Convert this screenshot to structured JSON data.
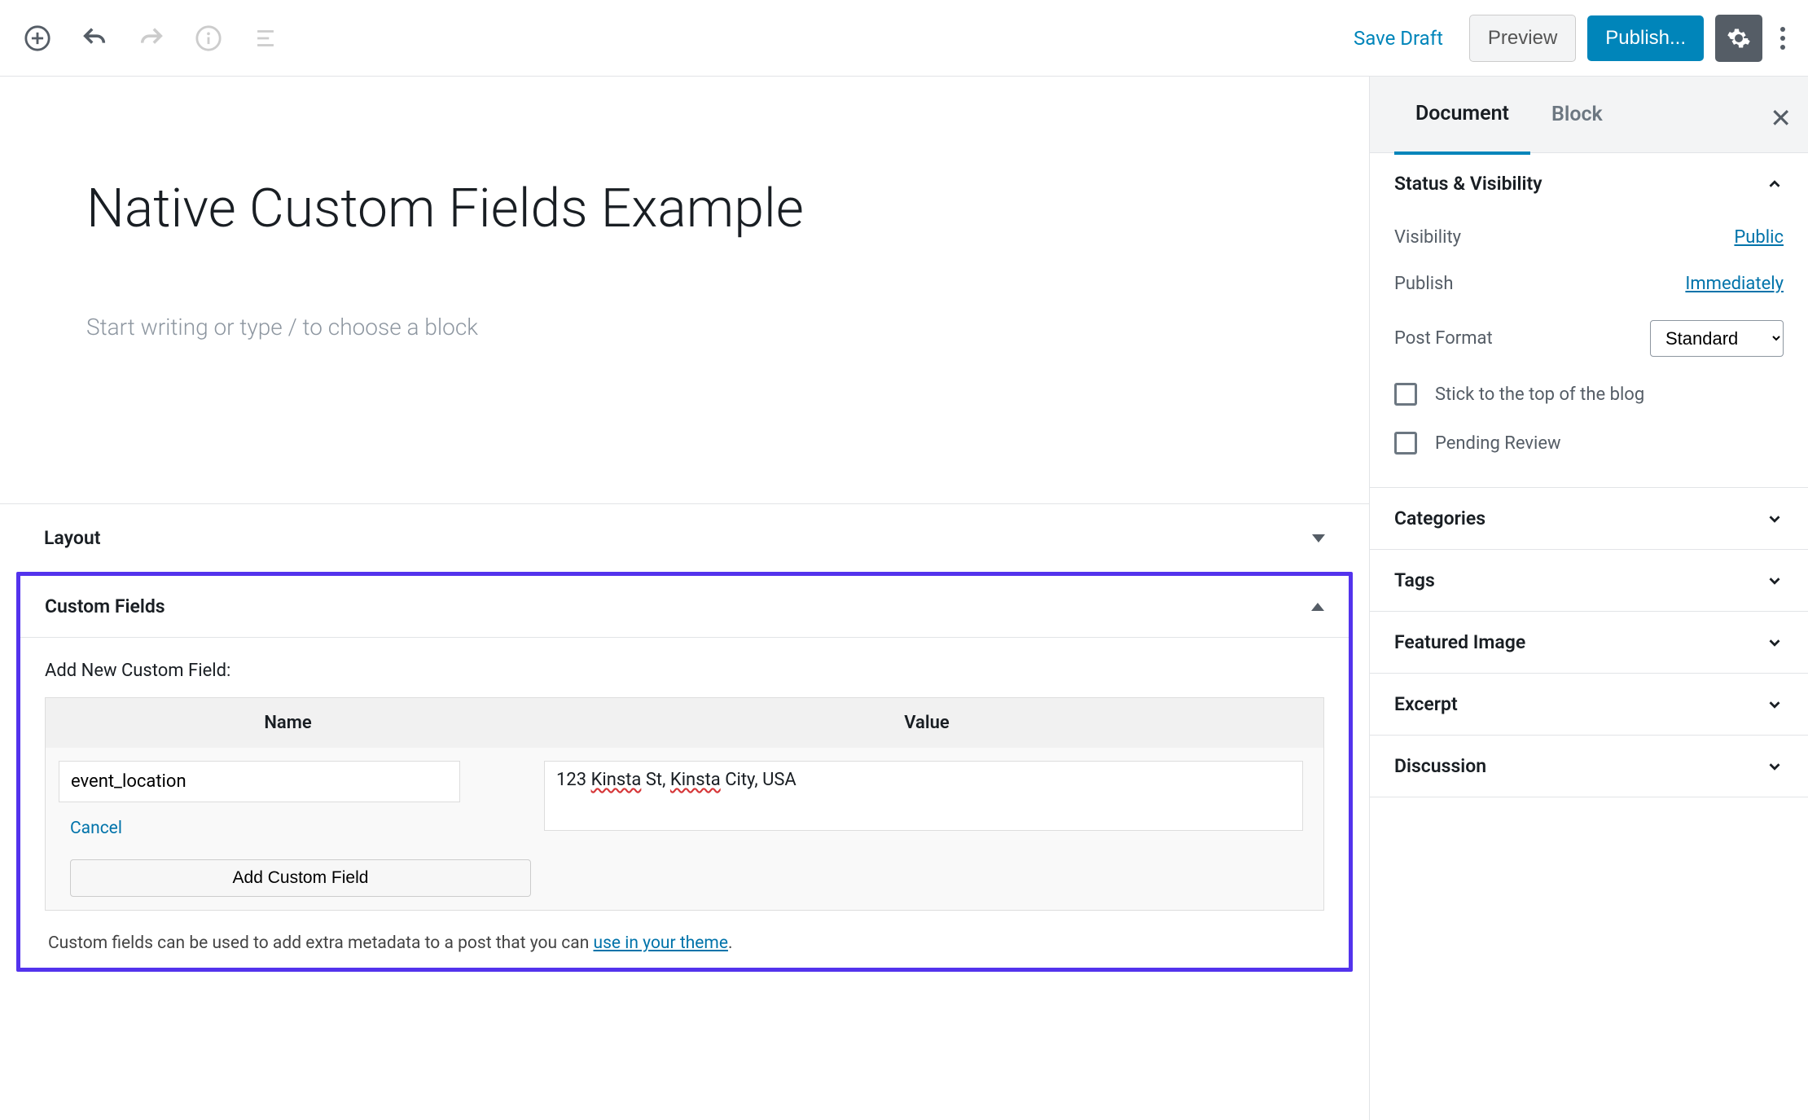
{
  "toolbar": {
    "save_draft": "Save Draft",
    "preview": "Preview",
    "publish": "Publish..."
  },
  "editor": {
    "title": "Native Custom Fields Example",
    "placeholder": "Start writing or type / to choose a block"
  },
  "metaboxes": {
    "layout": {
      "title": "Layout"
    },
    "custom_fields": {
      "title": "Custom Fields",
      "subtitle": "Add New Custom Field:",
      "columns": {
        "name": "Name",
        "value": "Value"
      },
      "name_value": "event_location",
      "value_prefix": "123 ",
      "value_spell1": "Kinsta",
      "value_mid": " St, ",
      "value_spell2": "Kinsta",
      "value_suffix": " City, USA",
      "cancel": "Cancel",
      "add_button": "Add Custom Field",
      "footer_text": "Custom fields can be used to add extra metadata to a post that you can ",
      "footer_link": "use in your theme",
      "footer_end": "."
    }
  },
  "sidebar": {
    "tabs": {
      "document": "Document",
      "block": "Block"
    },
    "status": {
      "title": "Status & Visibility",
      "visibility_label": "Visibility",
      "visibility_value": "Public",
      "publish_label": "Publish",
      "publish_value": "Immediately",
      "format_label": "Post Format",
      "format_value": "Standard",
      "stick_label": "Stick to the top of the blog",
      "pending_label": "Pending Review"
    },
    "panels": {
      "categories": "Categories",
      "tags": "Tags",
      "featured": "Featured Image",
      "excerpt": "Excerpt",
      "discussion": "Discussion"
    }
  }
}
